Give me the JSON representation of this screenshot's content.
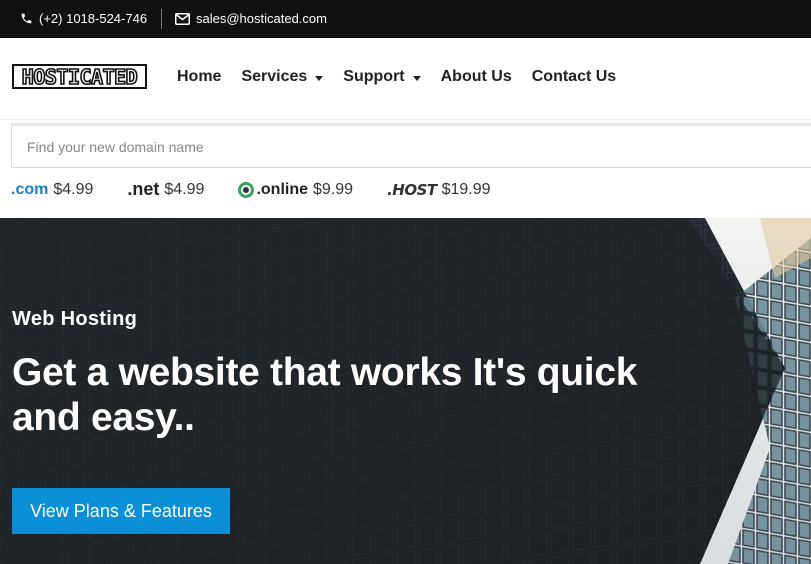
{
  "topbar": {
    "phone": "(+2) 1018-524-746",
    "email": "sales@hosticated.com"
  },
  "brand": {
    "logo_text": "HOSTICATED"
  },
  "nav": {
    "items": [
      {
        "label": "Home",
        "has_dropdown": false
      },
      {
        "label": "Services",
        "has_dropdown": true
      },
      {
        "label": "Support",
        "has_dropdown": true
      },
      {
        "label": "About Us",
        "has_dropdown": false
      },
      {
        "label": "Contact Us",
        "has_dropdown": false
      }
    ]
  },
  "domain_search": {
    "placeholder": "Find your new domain name",
    "value": ""
  },
  "tlds": [
    {
      "ext": ".com",
      "price": "$4.99"
    },
    {
      "ext": ".net",
      "price": "$4.99"
    },
    {
      "ext": ".online",
      "price": "$9.99"
    },
    {
      "ext": ".HOST",
      "price": "$19.99"
    }
  ],
  "hero": {
    "eyebrow": "Web Hosting",
    "title": "Get a website that works It's quick and easy..",
    "cta_label": "View Plans & Features"
  },
  "colors": {
    "topbar_bg": "#111111",
    "accent": "#0b8fd6",
    "hero_dark": "#20242a"
  }
}
